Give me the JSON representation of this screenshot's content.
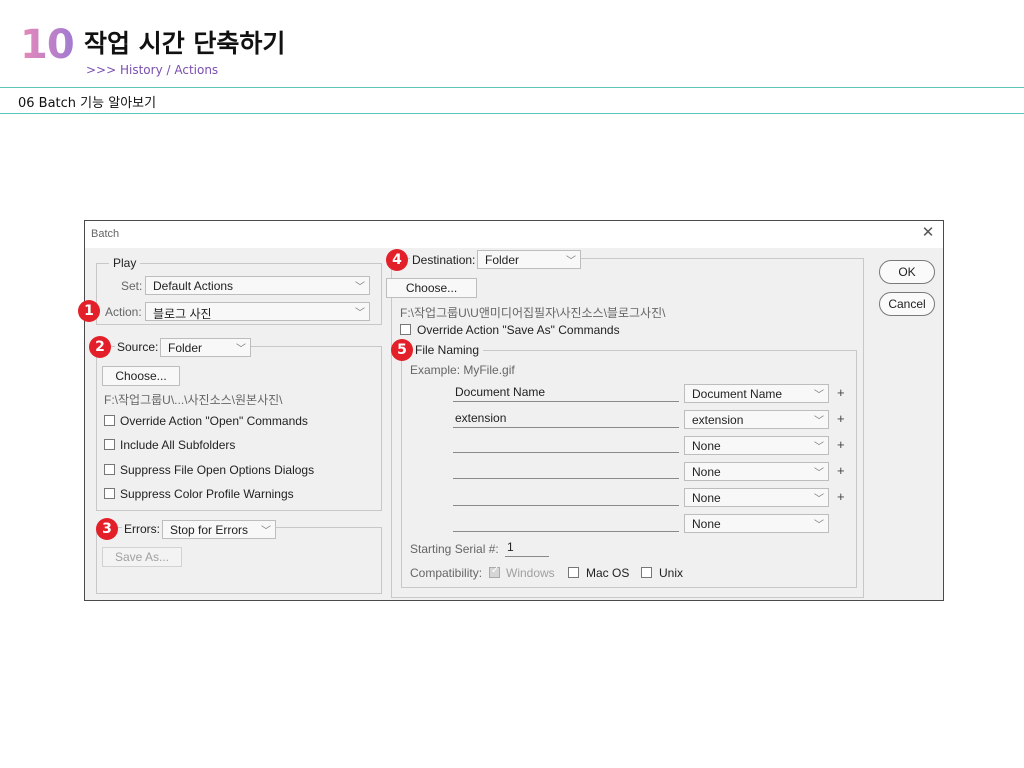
{
  "slide": {
    "chapter_number": "10",
    "chapter_title": "작업 시간 단축하기",
    "chapter_subtitle": ">>> History / Actions",
    "section_title": "06 Batch 기능 알아보기"
  },
  "dialog": {
    "title": "Batch",
    "markers": [
      "1",
      "2",
      "3",
      "4",
      "5"
    ],
    "play": {
      "legend": "Play",
      "set_label": "Set:",
      "set_value": "Default Actions",
      "action_label": "Action:",
      "action_value": "블로그 사진"
    },
    "source": {
      "label": "Source:",
      "value": "Folder",
      "choose_label": "Choose...",
      "path": "F:\\작업그룹U\\...\\사진소스\\원본사진\\",
      "options": [
        "Override Action \"Open\" Commands",
        "Include All Subfolders",
        "Suppress File Open Options Dialogs",
        "Suppress Color Profile Warnings"
      ]
    },
    "errors": {
      "label": "Errors:",
      "value": "Stop for Errors",
      "save_as_label": "Save As..."
    },
    "destination": {
      "label": "Destination:",
      "value": "Folder",
      "choose_label": "Choose...",
      "path": "F:\\작업그룹U\\U앤미디어집필자\\사진소스\\블로그사진\\",
      "override_label": "Override Action \"Save As\" Commands"
    },
    "file_naming": {
      "legend": "File Naming",
      "example": "Example: MyFile.gif",
      "rows": [
        {
          "field": "Document Name",
          "select": "Document Name"
        },
        {
          "field": "extension",
          "select": "extension"
        },
        {
          "field": "",
          "select": "None"
        },
        {
          "field": "",
          "select": "None"
        },
        {
          "field": "",
          "select": "None"
        },
        {
          "field": "",
          "select": "None"
        }
      ],
      "plus_symbol": "+",
      "serial_label": "Starting Serial #:",
      "serial_value": "1",
      "compat_label": "Compatibility:",
      "compat_options": [
        "Windows",
        "Mac OS",
        "Unix"
      ]
    },
    "buttons": {
      "ok": "OK",
      "cancel": "Cancel"
    }
  }
}
